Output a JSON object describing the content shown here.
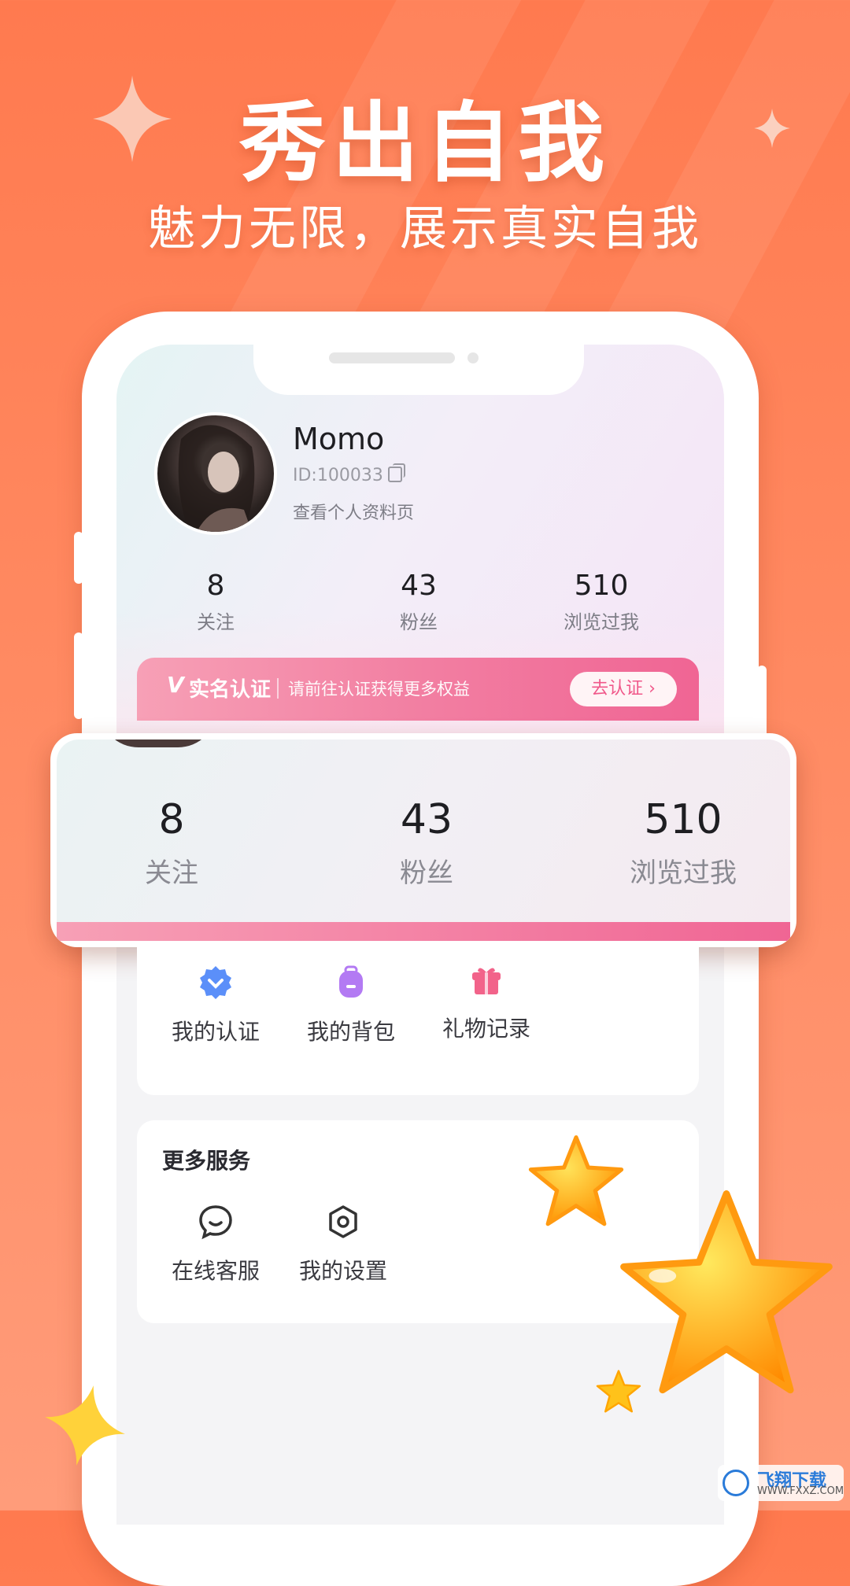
{
  "promo": {
    "headline": "秀出自我",
    "subline": "魅力无限，展示真实自我"
  },
  "profile": {
    "name": "Momo",
    "id_text": "ID:100033",
    "profile_link": "查看个人资料页"
  },
  "stats": [
    {
      "value": "8",
      "label": "关注"
    },
    {
      "value": "43",
      "label": "粉丝"
    },
    {
      "value": "510",
      "label": "浏览过我"
    }
  ],
  "verify_banner": {
    "icon": "V",
    "title": "实名认证",
    "desc": "请前往认证获得更多权益",
    "button": "去认证 ›"
  },
  "overlay_stats": [
    {
      "value": "8",
      "label": "关注"
    },
    {
      "value": "43",
      "label": "粉丝"
    },
    {
      "value": "510",
      "label": "浏览过我"
    }
  ],
  "my_items": [
    {
      "label": "我的认证",
      "icon": "verified-badge-icon",
      "color": "#5b8ff9"
    },
    {
      "label": "我的背包",
      "icon": "backpack-icon",
      "color": "#b37af3"
    },
    {
      "label": "礼物记录",
      "icon": "gift-icon",
      "color": "#f2638a"
    }
  ],
  "more_services": {
    "title": "更多服务",
    "items": [
      {
        "label": "在线客服",
        "icon": "chat-bubble-icon"
      },
      {
        "label": "我的设置",
        "icon": "settings-hexagon-icon"
      }
    ]
  },
  "watermark": {
    "brand": "飞翔下载",
    "url": "WWW.FXXZ.COM"
  },
  "colors": {
    "background": "#ff7a4f",
    "accent_pink": "#f06594",
    "star_yellow": "#ffc21a",
    "star_orange": "#ff8f00"
  }
}
